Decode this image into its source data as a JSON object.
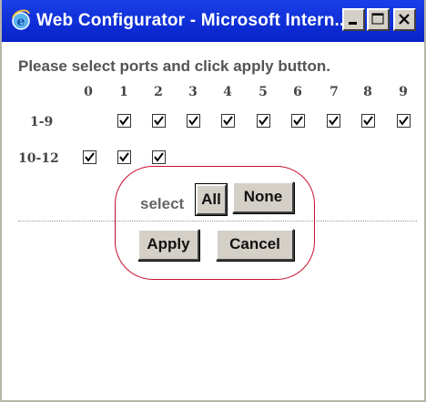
{
  "window": {
    "title": "Web Configurator - Microsoft Intern...",
    "minimize_icon": "minimize-icon",
    "maximize_icon": "maximize-icon",
    "close_icon": "close-icon"
  },
  "instruction": "Please select ports and click apply button.",
  "columns": [
    "0",
    "1",
    "2",
    "3",
    "4",
    "5",
    "6",
    "7",
    "8",
    "9"
  ],
  "rows": [
    {
      "label": "1-9",
      "checked": [
        null,
        true,
        true,
        true,
        true,
        true,
        true,
        true,
        true,
        true
      ]
    },
    {
      "label": "10-12",
      "checked": [
        true,
        true,
        true
      ]
    }
  ],
  "select": {
    "label": "select",
    "all_label": "All",
    "none_label": "None"
  },
  "actions": {
    "apply_label": "Apply",
    "cancel_label": "Cancel"
  },
  "colors": {
    "titlebar": "#0a2ce0",
    "highlight": "#c8102e"
  }
}
